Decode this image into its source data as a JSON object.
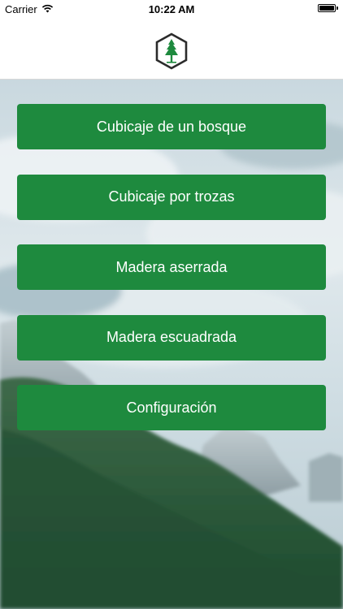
{
  "status_bar": {
    "carrier": "Carrier",
    "time": "10:22 AM",
    "battery_level": 1.0
  },
  "header": {
    "logo_icon": "tree-hexagon-logo-icon"
  },
  "menu": {
    "items": [
      {
        "label": "Cubicaje de un bosque"
      },
      {
        "label": "Cubicaje por trozas"
      },
      {
        "label": "Madera aserrada"
      },
      {
        "label": "Madera escuadrada"
      },
      {
        "label": "Configuración"
      }
    ]
  },
  "colors": {
    "button_bg": "#1e8a3e",
    "button_text": "#ffffff",
    "logo_green": "#1e8a3e"
  }
}
